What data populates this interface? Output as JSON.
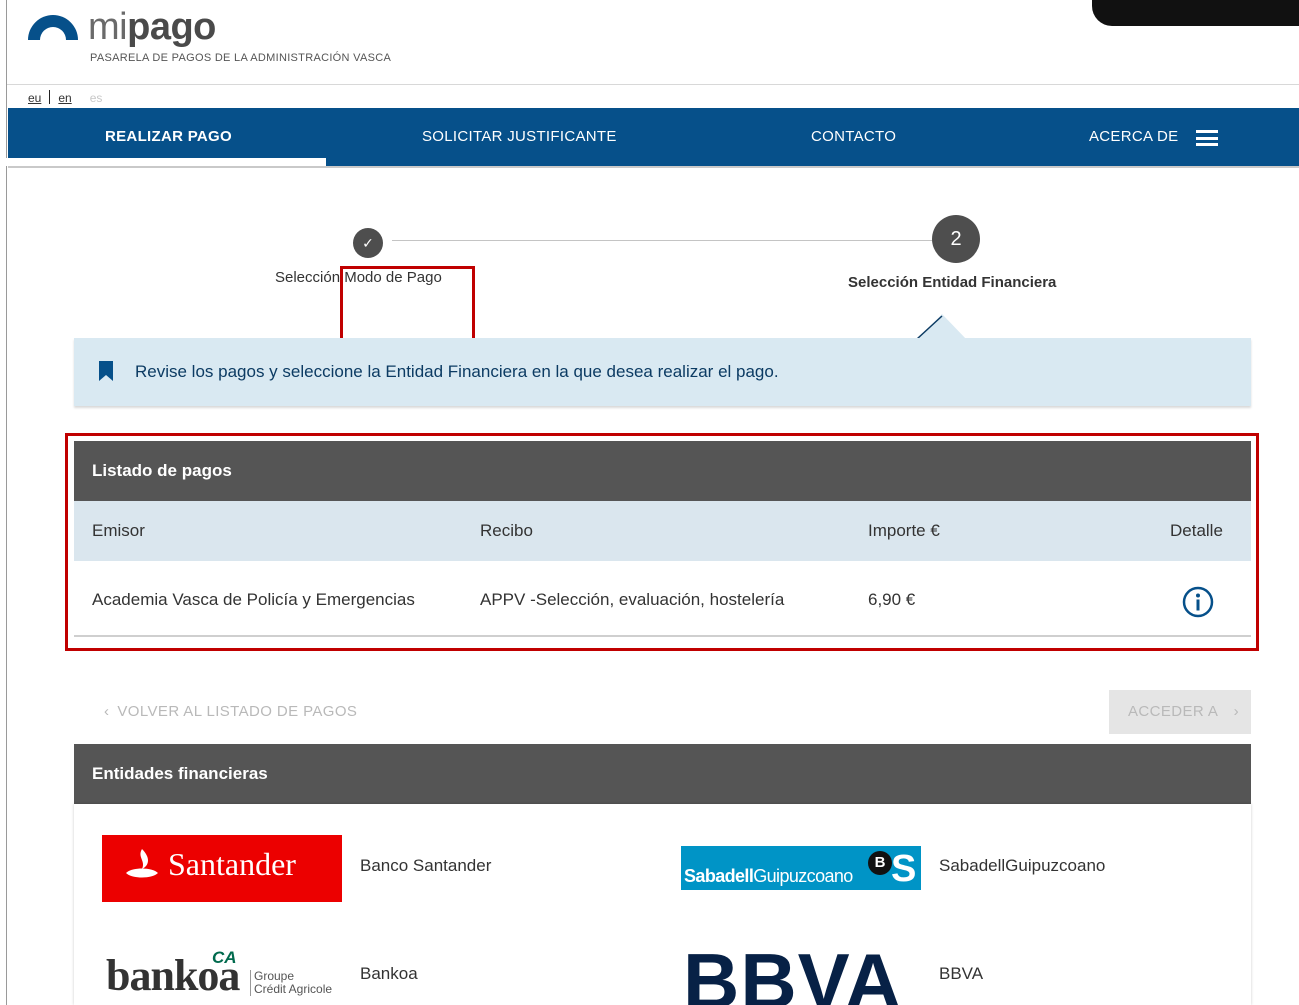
{
  "header": {
    "logo_prefix": "mi",
    "logo_bold": "pago",
    "subtitle": "PASARELA DE PAGOS DE LA ADMINISTRACIÓN VASCA",
    "languages": [
      "eu",
      "en",
      "es"
    ]
  },
  "nav": {
    "items": [
      {
        "label": "REALIZAR PAGO",
        "active": true
      },
      {
        "label": "SOLICITAR JUSTIFICANTE",
        "active": false
      },
      {
        "label": "CONTACTO",
        "active": false
      },
      {
        "label": "ACERCA DE",
        "active": false
      }
    ]
  },
  "stepper": {
    "step1": {
      "mark": "✓",
      "label": "Selección Modo de Pago",
      "status": "completed"
    },
    "step2": {
      "number": "2",
      "label": "Selección Entidad Financiera",
      "status": "current"
    }
  },
  "info": {
    "message": "Revise los pagos y seleccione la Entidad Financiera en la que desea realizar el pago."
  },
  "listado": {
    "title": "Listado de pagos",
    "columns": [
      "Emisor",
      "Recibo",
      "Importe €",
      "Detalle"
    ],
    "rows": [
      {
        "emisor": "Academia Vasca de Policía y Emergencias",
        "recibo": "APPV -Selección, evaluación, hostelería",
        "importe": "6,90 €",
        "detalle_icon": "info-icon"
      }
    ]
  },
  "actions": {
    "back_label": "VOLVER AL LISTADO DE PAGOS",
    "next_label": "ACCEDER A"
  },
  "entidades": {
    "title": "Entidades financieras",
    "items": [
      {
        "name": "Banco Santander",
        "logo_text": "Santander"
      },
      {
        "name": "SabadellGuipuzcoano",
        "logo_text_bold": "Sabadell",
        "logo_text": "Guipuzcoano",
        "logo_badge": "B",
        "logo_letter": "S"
      },
      {
        "name": "Bankoa",
        "logo_text": "bankoa",
        "logo_mark": "CA",
        "logo_group": "Groupe",
        "logo_group2": "Crédit Agricole"
      },
      {
        "name": "BBVA",
        "logo_text": "BBVA"
      }
    ]
  },
  "colors": {
    "nav_bg": "#06508a",
    "panel_head": "#555555",
    "info_bg": "#d9e9f2",
    "highlight": "#c00000",
    "santander": "#ec0000",
    "sabadell": "#0094c6",
    "bbva": "#072146"
  }
}
